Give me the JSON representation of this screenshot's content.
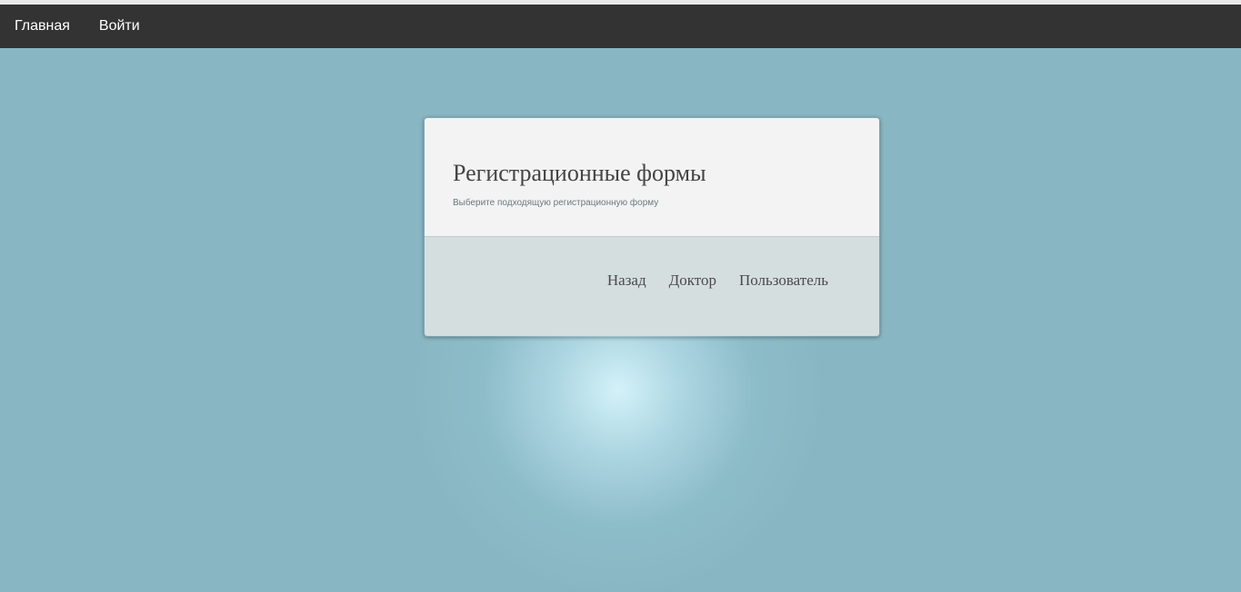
{
  "navbar": {
    "items": [
      {
        "label": "Главная"
      },
      {
        "label": "Войти"
      }
    ]
  },
  "card": {
    "title": "Регистрационные формы",
    "subtitle": "Выберите подходящую регистрационную форму",
    "links": [
      {
        "label": "Назад"
      },
      {
        "label": "Доктор"
      },
      {
        "label": "Пользователь"
      }
    ]
  },
  "colors": {
    "navbar_bg": "#333333",
    "page_bg": "#89b6c3",
    "card_head_bg": "#f3f3f3",
    "card_foot_bg": "#d5dedf"
  }
}
